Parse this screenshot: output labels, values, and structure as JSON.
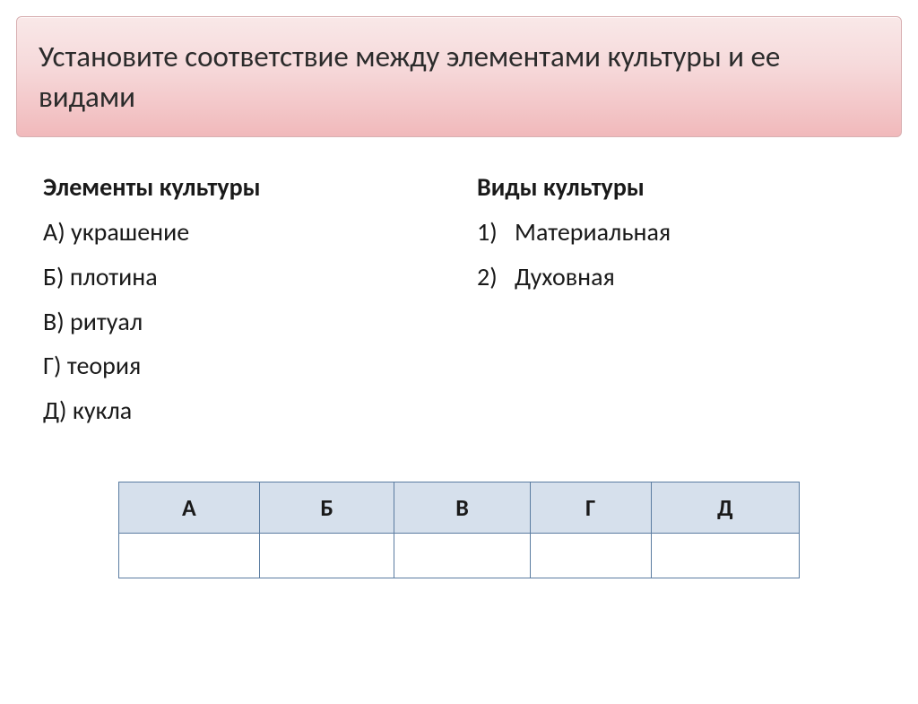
{
  "title": "Установите соответствие между элементами культуры и ее видами",
  "left": {
    "heading": "Элементы культуры",
    "items": [
      "А) украшение",
      "Б) плотина",
      "В) ритуал",
      "Г) теория",
      "Д) кукла"
    ]
  },
  "right": {
    "heading": "Виды культуры",
    "items": [
      {
        "num": "1)",
        "text": "Материальная"
      },
      {
        "num": "2)",
        "text": "Духовная"
      }
    ]
  },
  "table": {
    "headers": [
      "А",
      "Б",
      "В",
      "Г",
      "Д"
    ],
    "answers": [
      "",
      "",
      "",
      "",
      ""
    ]
  }
}
